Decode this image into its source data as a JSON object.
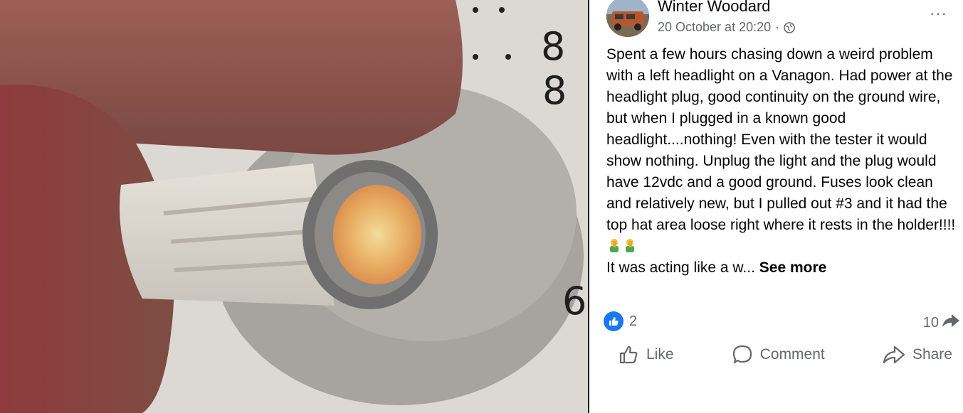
{
  "post": {
    "author": "Winter Woodard",
    "timestamp": "20 October at 20:20",
    "separator": "·",
    "privacy_icon": "globe-icon",
    "more_label": "···",
    "body_lines": [
      "Spent a few hours chasing down a weird problem with a left headlight on a Vanagon. Had power at the headlight plug, good continuity on the ground wire, but when I plugged in a known good headlight....nothing! Even with the tester it would show nothing. Unplug the light and the plug would have 12vdc and a good ground. Fuses look clean and relatively new, but I pulled out #3 and it had the top hat area loose right where it rests in the holder!!!!",
      "It was acting like a w..."
    ],
    "see_more": "See more",
    "reaction_count": "2",
    "share_count": "10",
    "actions": {
      "like": "Like",
      "comment": "Comment",
      "share": "Share"
    }
  },
  "photo": {
    "ruler_digits": [
      "8",
      "8",
      "6"
    ]
  },
  "colors": {
    "accent": "#1877f2",
    "secondary_text": "#65676b",
    "primary_text": "#050505"
  }
}
